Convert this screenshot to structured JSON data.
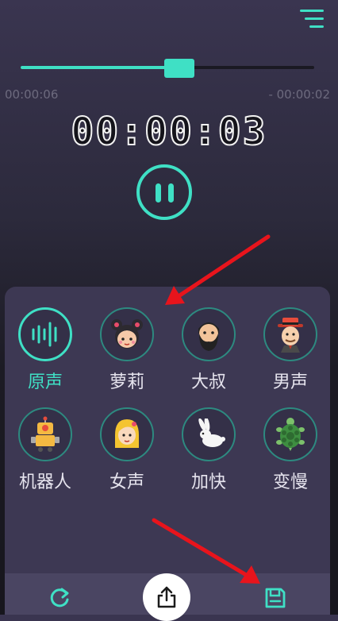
{
  "player": {
    "progress_fraction": 0.54,
    "elapsed": "00:00:06",
    "remaining": "- 00:00:02",
    "recording_time": "00:00:03"
  },
  "effects": [
    {
      "label": "原声",
      "icon": "waveform-icon",
      "active": true
    },
    {
      "label": "萝莉",
      "icon": "girl-icon",
      "active": false
    },
    {
      "label": "大叔",
      "icon": "bearded-man-icon",
      "active": false
    },
    {
      "label": "男声",
      "icon": "man-with-hat-icon",
      "active": false
    },
    {
      "label": "机器人",
      "icon": "robot-icon",
      "active": false
    },
    {
      "label": "女声",
      "icon": "woman-icon",
      "active": false
    },
    {
      "label": "加快",
      "icon": "rabbit-icon",
      "active": false
    },
    {
      "label": "变慢",
      "icon": "turtle-icon",
      "active": false
    }
  ],
  "bottom_bar": {
    "left": "refresh-icon",
    "center": "share-icon",
    "right": "save-icon"
  },
  "colors": {
    "accent": "#3fe0c5",
    "panel": "#3d3853",
    "annotation_arrow": "#e8141c"
  }
}
